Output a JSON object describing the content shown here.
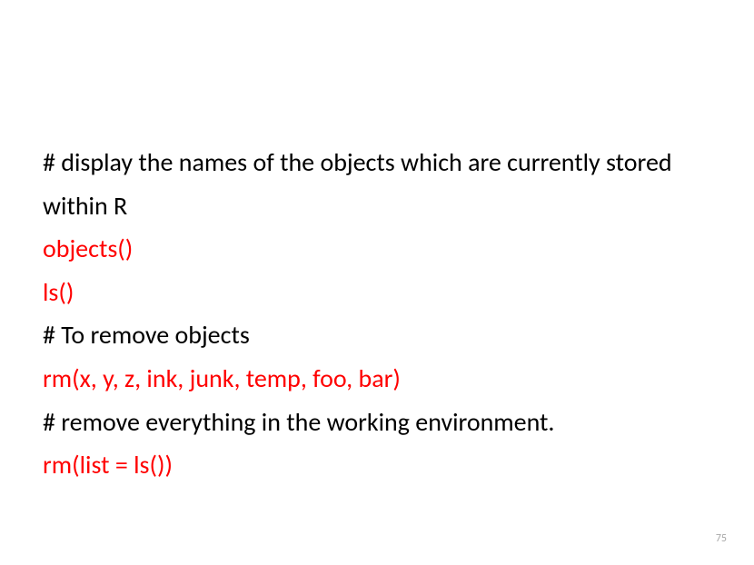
{
  "slide": {
    "lines": [
      {
        "text": "# display the names of the objects which are currently stored within R",
        "red": false
      },
      {
        "text": "objects()",
        "red": true
      },
      {
        "text": "ls()",
        "red": true
      },
      {
        "text": "# To remove objects",
        "red": false
      },
      {
        "text": "rm(x, y, z, ink, junk, temp, foo, bar)",
        "red": true
      },
      {
        "text": "# remove everything in the working environment.",
        "red": false
      },
      {
        "text": "rm(list = ls())",
        "red": true
      }
    ],
    "page_number": "75"
  }
}
